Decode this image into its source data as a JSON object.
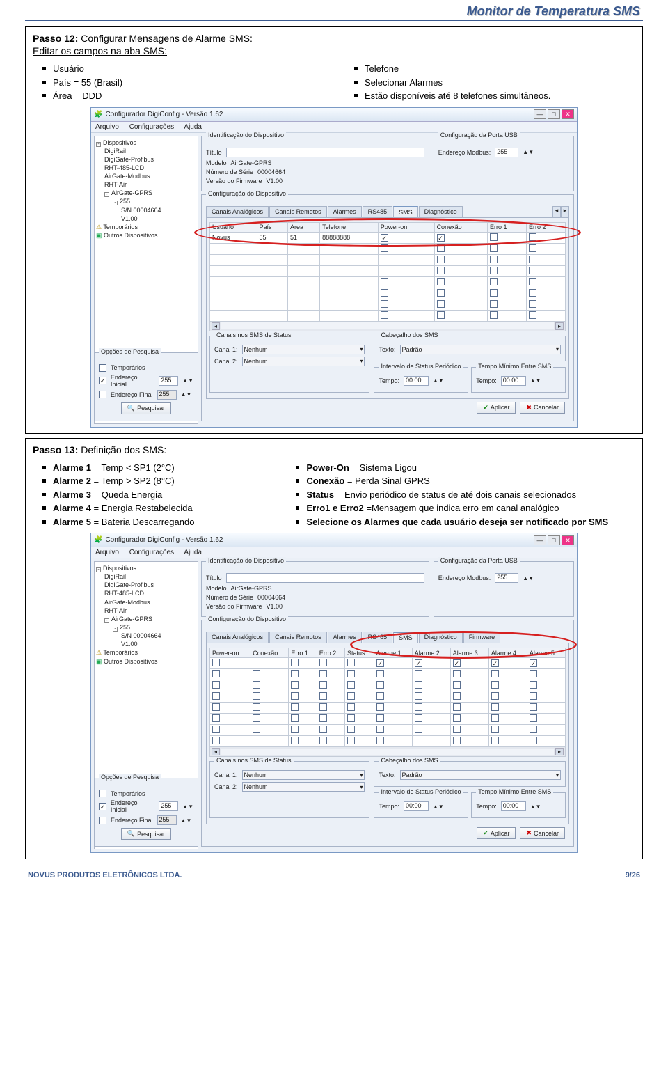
{
  "header": {
    "title": "Monitor de Temperatura SMS"
  },
  "section1": {
    "line1_label": "Passo 12:",
    "line1_rest": " Configurar Mensagens de Alarme SMS:",
    "line2": "Editar os campos na aba SMS:",
    "left_bullets": [
      "Usuário",
      "País = 55 (Brasil)",
      "Área = DDD"
    ],
    "right_bullets": [
      "Telefone",
      "Selecionar Alarmes",
      "Estão disponíveis até 8 telefones simultâneos."
    ]
  },
  "section2": {
    "line1_label": "Passo 13:",
    "line1_rest": " Definição dos SMS:",
    "left_bullets": [
      "<b>Alarme 1</b> = Temp < SP1 (2°C)",
      "<b>Alarme 2</b> = Temp > SP2 (8°C)",
      "<b>Alarme 3</b> = Queda Energia",
      "<b>Alarme 4</b> = Energia Restabelecida",
      "<b>Alarme 5</b> = Bateria Descarregando"
    ],
    "right_bullets": [
      "<b>Power-On</b> = Sistema Ligou",
      "<b>Conexão</b> = Perda Sinal GPRS",
      "<b>Status</b> = Envio periódico de status de até dois canais selecionados",
      "<b>Erro1 e Erro2</b> =Mensagem que indica erro em canal analógico",
      "<b>Selecione os Alarmes que cada usuário deseja ser notificado por SMS</b>"
    ]
  },
  "shot_common": {
    "window_title": "Configurador DigiConfig - Versão 1.62",
    "menu": [
      "Arquivo",
      "Configurações",
      "Ajuda"
    ],
    "tree": {
      "root": "Dispositivos",
      "items": [
        "DigiRail",
        "DigiGate-Profibus",
        "RHT-485-LCD",
        "AirGate-Modbus",
        "RHT-Air",
        "AirGate-GPRS"
      ],
      "addr": "255",
      "sn": "S/N 00004664",
      "ver": "V1.00",
      "temporarios": "Temporários",
      "outros": "Outros Dispositivos"
    },
    "id_box": {
      "legend": "Identificação do Dispositivo",
      "titulo": "Título",
      "modelo": "Modelo",
      "modelo_val": "AirGate-GPRS",
      "serie": "Número de Série",
      "serie_val": "00004664",
      "fw": "Versão do Firmware",
      "fw_val": "V1.00"
    },
    "usb_box": {
      "legend": "Configuração da Porta USB",
      "addr_lbl": "Endereço Modbus:",
      "addr_val": "255"
    },
    "conf_box": {
      "legend": "Configuração do Dispositivo"
    },
    "options": {
      "legend": "Opções de Pesquisa",
      "temporarios": "Temporários",
      "eini": "Endereço Inicial",
      "eini_val": "255",
      "efin": "Endereço Final",
      "efin_val": "255",
      "pesquisar": "Pesquisar"
    },
    "status_box": {
      "legend": "Canais nos SMS de Status",
      "c1": "Canal 1:",
      "c2": "Canal 2:",
      "nenhum": "Nenhum"
    },
    "cab_box": {
      "legend": "Cabeçalho dos SMS",
      "texto": "Texto:",
      "padrao": "Padrão"
    },
    "intv_box": {
      "legend": "Intervalo de Status Periódico",
      "tempo": "Tempo:",
      "val": "00:00"
    },
    "min_box": {
      "legend": "Tempo Mínimo Entre SMS",
      "tempo": "Tempo:",
      "val": "00:00"
    },
    "aplicar": "Aplicar",
    "cancelar": "Cancelar"
  },
  "shot1": {
    "tabs": [
      "Canais Analógicos",
      "Canais Remotos",
      "Alarmes",
      "RS485",
      "SMS",
      "Diagnóstico"
    ],
    "active_tab": "SMS",
    "headers": [
      "Usuário",
      "País",
      "Área",
      "Telefone",
      "Power-on",
      "Conexão",
      "Erro 1",
      "Erro 2"
    ],
    "row": {
      "usuario": "Novus",
      "pais": "55",
      "area": "51",
      "tel": "88888888",
      "poweron": true,
      "conexao": true
    }
  },
  "shot2": {
    "tabs": [
      "Canais Analógicos",
      "Canais Remotos",
      "Alarmes",
      "RS485",
      "SMS",
      "Diagnóstico",
      "Firmware"
    ],
    "active_tab": "SMS",
    "headers": [
      "Power-on",
      "Conexão",
      "Erro 1",
      "Erro 2",
      "Status",
      "Alarme 1",
      "Alarme 2",
      "Alarme 3",
      "Alarme 4",
      "Alarme 5"
    ],
    "row_checks": [
      false,
      false,
      false,
      false,
      false,
      true,
      true,
      true,
      true,
      true
    ]
  },
  "footer": {
    "left": "NOVUS PRODUTOS ELETRÔNICOS LTDA.",
    "right": "9/26"
  }
}
